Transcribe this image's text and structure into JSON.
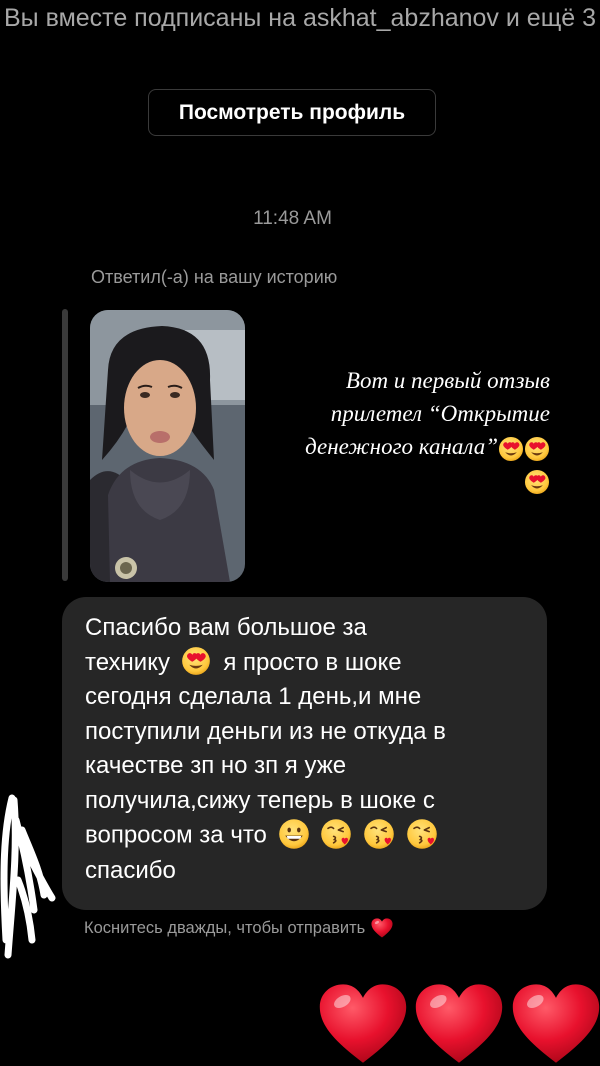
{
  "thread": {
    "mutual_text": "Вы вместе подписаны на askhat_abzhanov и ещё 3",
    "view_profile_label": "Посмотреть профиль",
    "timestamp": "11:48 AM",
    "replied_label": "Ответил(-а) на вашу историю"
  },
  "story": {
    "caption_line1": "Вот и первый отзыв",
    "caption_line2": "прилетел “Открытие",
    "caption_line3": "денежного канала”",
    "caption_emojis": [
      "heart-eyes-emoji",
      "heart-eyes-emoji",
      "heart-eyes-emoji"
    ]
  },
  "message": {
    "line1": "Спасибо вам большое за",
    "line2a": "технику",
    "line2b": "я просто в шоке",
    "line3": "сегодня сделала 1 день,и мне",
    "line4": "поступили деньги из не откуда в",
    "line5": "качестве зп но зп я уже",
    "line6": "получила,сижу теперь в шоке с",
    "line7": "вопросом за что",
    "line8": "спасибо",
    "emojis_line2": [
      "heart-eyes-emoji"
    ],
    "emojis_line7": [
      "grinning-emoji",
      "kissing-heart-emoji",
      "kissing-heart-emoji",
      "kissing-heart-emoji"
    ]
  },
  "composer": {
    "double_tap_hint": "Коснитесь дважды, чтобы отправить"
  },
  "decorations": {
    "big_hearts": [
      "heart-icon",
      "heart-icon",
      "heart-icon"
    ]
  },
  "colors": {
    "background": "#000000",
    "bubble": "#262626",
    "secondary_text": "#9a9a9a",
    "heart_red": "#e8112d",
    "emoji_yellow": "#ffcc4d"
  }
}
